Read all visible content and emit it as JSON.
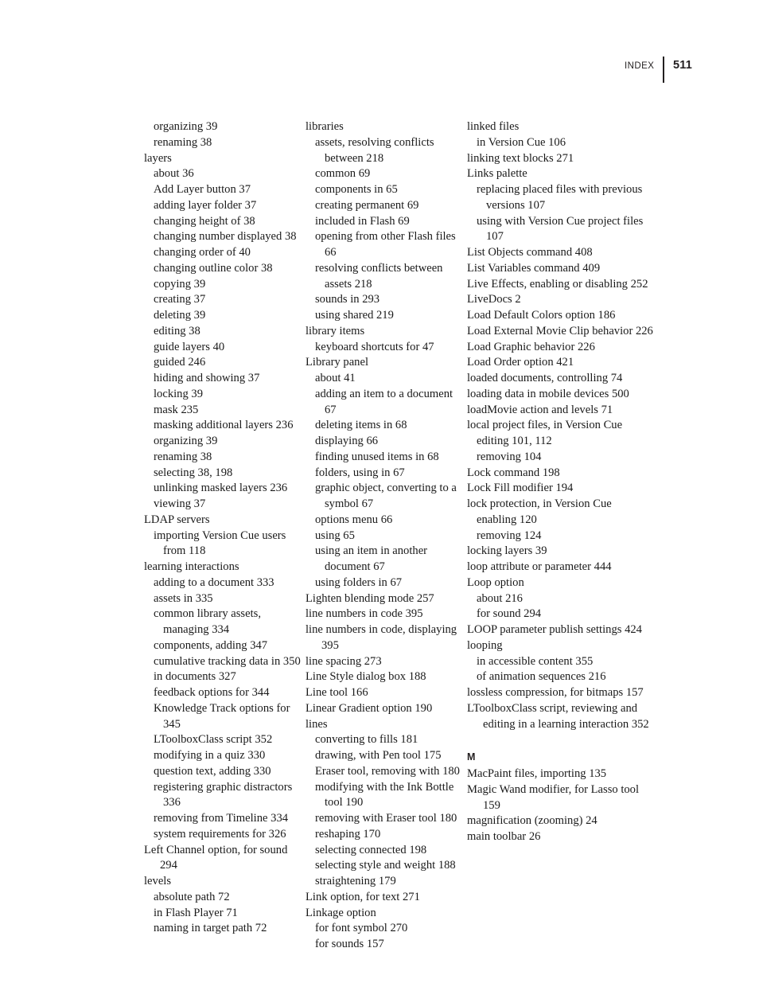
{
  "header": {
    "label": "INDEX",
    "page_number": "511"
  },
  "columns": [
    {
      "id": "column-1",
      "entries": [
        {
          "level": 1,
          "text": "organizing 39"
        },
        {
          "level": 1,
          "text": "renaming 38"
        },
        {
          "level": 0,
          "text": "layers"
        },
        {
          "level": 1,
          "text": "about 36"
        },
        {
          "level": 1,
          "text": "Add Layer button 37"
        },
        {
          "level": 1,
          "text": "adding layer folder 37"
        },
        {
          "level": 1,
          "text": "changing height of 38"
        },
        {
          "level": 1,
          "text": "changing number displayed 38"
        },
        {
          "level": 1,
          "text": "changing order of 40"
        },
        {
          "level": 1,
          "text": "changing outline color 38"
        },
        {
          "level": 1,
          "text": "copying 39"
        },
        {
          "level": 1,
          "text": "creating 37"
        },
        {
          "level": 1,
          "text": "deleting 39"
        },
        {
          "level": 1,
          "text": "editing 38"
        },
        {
          "level": 1,
          "text": "guide layers 40"
        },
        {
          "level": 1,
          "text": "guided 246"
        },
        {
          "level": 1,
          "text": "hiding and showing 37"
        },
        {
          "level": 1,
          "text": "locking 39"
        },
        {
          "level": 1,
          "text": "mask 235"
        },
        {
          "level": 1,
          "text": "masking additional layers 236"
        },
        {
          "level": 1,
          "text": "organizing 39"
        },
        {
          "level": 1,
          "text": "renaming 38"
        },
        {
          "level": 1,
          "text": "selecting 38, 198"
        },
        {
          "level": 1,
          "text": "unlinking masked layers 236"
        },
        {
          "level": 1,
          "text": "viewing 37"
        },
        {
          "level": 0,
          "text": "LDAP servers"
        },
        {
          "level": 1,
          "text": "importing Version Cue users from 118"
        },
        {
          "level": 0,
          "text": "learning interactions"
        },
        {
          "level": 1,
          "text": "adding to a document 333"
        },
        {
          "level": 1,
          "text": "assets in 335"
        },
        {
          "level": 1,
          "text": "common library assets, managing 334"
        },
        {
          "level": 1,
          "text": "components, adding 347"
        },
        {
          "level": 1,
          "text": "cumulative tracking data in 350"
        },
        {
          "level": 1,
          "text": "in documents 327"
        },
        {
          "level": 1,
          "text": "feedback options for 344"
        },
        {
          "level": 1,
          "text": "Knowledge Track options for 345"
        },
        {
          "level": 1,
          "text": "LToolboxClass script 352"
        },
        {
          "level": 1,
          "text": "modifying in a quiz 330"
        },
        {
          "level": 1,
          "text": "question text, adding 330"
        },
        {
          "level": 1,
          "text": "registering graphic distractors 336"
        },
        {
          "level": 1,
          "text": "removing from Timeline 334"
        },
        {
          "level": 1,
          "text": "system requirements for 326"
        },
        {
          "level": 0,
          "text": "Left Channel option, for sound 294"
        },
        {
          "level": 0,
          "text": "levels"
        },
        {
          "level": 1,
          "text": "absolute path 72"
        },
        {
          "level": 1,
          "text": "in Flash Player 71"
        },
        {
          "level": 1,
          "text": "naming in target path 72"
        }
      ]
    },
    {
      "id": "column-2",
      "entries": [
        {
          "level": 0,
          "text": "libraries"
        },
        {
          "level": 1,
          "text": "assets, resolving conflicts between 218"
        },
        {
          "level": 1,
          "text": "common 69"
        },
        {
          "level": 1,
          "text": "components in 65"
        },
        {
          "level": 1,
          "text": "creating permanent 69"
        },
        {
          "level": 1,
          "text": "included in Flash 69"
        },
        {
          "level": 1,
          "text": "opening from other Flash files 66"
        },
        {
          "level": 1,
          "text": "resolving conflicts between assets 218"
        },
        {
          "level": 1,
          "text": "sounds in 293"
        },
        {
          "level": 1,
          "text": "using shared 219"
        },
        {
          "level": 0,
          "text": "library items"
        },
        {
          "level": 1,
          "text": "keyboard shortcuts for 47"
        },
        {
          "level": 0,
          "text": "Library panel"
        },
        {
          "level": 1,
          "text": "about 41"
        },
        {
          "level": 1,
          "text": "adding an item to a document 67"
        },
        {
          "level": 1,
          "text": "deleting items in 68"
        },
        {
          "level": 1,
          "text": "displaying 66"
        },
        {
          "level": 1,
          "text": "finding unused items in 68"
        },
        {
          "level": 1,
          "text": "folders, using in 67"
        },
        {
          "level": 1,
          "text": "graphic object, converting to a symbol 67"
        },
        {
          "level": 1,
          "text": "options menu 66"
        },
        {
          "level": 1,
          "text": "using 65"
        },
        {
          "level": 1,
          "text": "using an item in another document 67"
        },
        {
          "level": 1,
          "text": "using folders in 67"
        },
        {
          "level": 0,
          "text": "Lighten blending mode 257"
        },
        {
          "level": 0,
          "text": "line numbers in code 395"
        },
        {
          "level": 0,
          "text": "line numbers in code, displaying 395"
        },
        {
          "level": 0,
          "text": "line spacing 273"
        },
        {
          "level": 0,
          "text": "Line Style dialog box 188"
        },
        {
          "level": 0,
          "text": "Line tool 166"
        },
        {
          "level": 0,
          "text": "Linear Gradient option 190"
        },
        {
          "level": 0,
          "text": "lines"
        },
        {
          "level": 1,
          "text": "converting to fills 181"
        },
        {
          "level": 1,
          "text": "drawing, with Pen tool 175"
        },
        {
          "level": 1,
          "text": "Eraser tool, removing with 180"
        },
        {
          "level": 1,
          "text": "modifying with the Ink Bottle tool 190"
        },
        {
          "level": 1,
          "text": "removing with Eraser tool 180"
        },
        {
          "level": 1,
          "text": "reshaping 170"
        },
        {
          "level": 1,
          "text": "selecting connected 198"
        },
        {
          "level": 1,
          "text": "selecting style and weight 188"
        },
        {
          "level": 1,
          "text": "straightening 179"
        },
        {
          "level": 0,
          "text": "Link option, for text 271"
        },
        {
          "level": 0,
          "text": "Linkage option"
        },
        {
          "level": 1,
          "text": "for font symbol 270"
        },
        {
          "level": 1,
          "text": "for sounds 157"
        }
      ]
    },
    {
      "id": "column-3",
      "entries": [
        {
          "level": 0,
          "text": "linked files"
        },
        {
          "level": 1,
          "text": "in Version Cue 106"
        },
        {
          "level": 0,
          "text": "linking text blocks 271"
        },
        {
          "level": 0,
          "text": "Links palette"
        },
        {
          "level": 1,
          "text": "replacing placed files with previous versions 107"
        },
        {
          "level": 1,
          "text": "using with Version Cue project files 107"
        },
        {
          "level": 0,
          "text": "List Objects command 408"
        },
        {
          "level": 0,
          "text": "List Variables command 409"
        },
        {
          "level": 0,
          "text": "Live Effects, enabling or disabling 252"
        },
        {
          "level": 0,
          "text": "LiveDocs 2"
        },
        {
          "level": 0,
          "text": "Load Default Colors option 186"
        },
        {
          "level": 0,
          "text": "Load External Movie Clip behavior 226"
        },
        {
          "level": 0,
          "text": "Load Graphic behavior 226"
        },
        {
          "level": 0,
          "text": "Load Order option 421"
        },
        {
          "level": 0,
          "text": "loaded documents, controlling 74"
        },
        {
          "level": 0,
          "text": "loading data in mobile devices 500"
        },
        {
          "level": 0,
          "text": "loadMovie action and levels 71"
        },
        {
          "level": 0,
          "text": "local project files, in Version Cue"
        },
        {
          "level": 1,
          "text": "editing 101, 112"
        },
        {
          "level": 1,
          "text": "removing 104"
        },
        {
          "level": 0,
          "text": "Lock command 198"
        },
        {
          "level": 0,
          "text": "Lock Fill modifier 194"
        },
        {
          "level": 0,
          "text": "lock protection, in Version Cue"
        },
        {
          "level": 1,
          "text": "enabling 120"
        },
        {
          "level": 1,
          "text": "removing 124"
        },
        {
          "level": 0,
          "text": "locking layers 39"
        },
        {
          "level": 0,
          "text": "loop attribute or parameter 444"
        },
        {
          "level": 0,
          "text": "Loop option"
        },
        {
          "level": 1,
          "text": "about 216"
        },
        {
          "level": 1,
          "text": "for sound 294"
        },
        {
          "level": 0,
          "text": "LOOP parameter publish settings 424"
        },
        {
          "level": 0,
          "text": "looping"
        },
        {
          "level": 1,
          "text": "in accessible content 355"
        },
        {
          "level": 1,
          "text": "of animation sequences 216"
        },
        {
          "level": 0,
          "text": "lossless compression, for bitmaps 157"
        },
        {
          "level": 0,
          "text": "LToolboxClass script, reviewing and editing in a learning interaction 352"
        },
        {
          "level": "letter",
          "text": "M"
        },
        {
          "level": 0,
          "text": "MacPaint files, importing 135"
        },
        {
          "level": 0,
          "text": "Magic Wand modifier, for Lasso tool 159"
        },
        {
          "level": 0,
          "text": "magnification (zooming) 24"
        },
        {
          "level": 0,
          "text": "main toolbar 26"
        }
      ]
    }
  ]
}
